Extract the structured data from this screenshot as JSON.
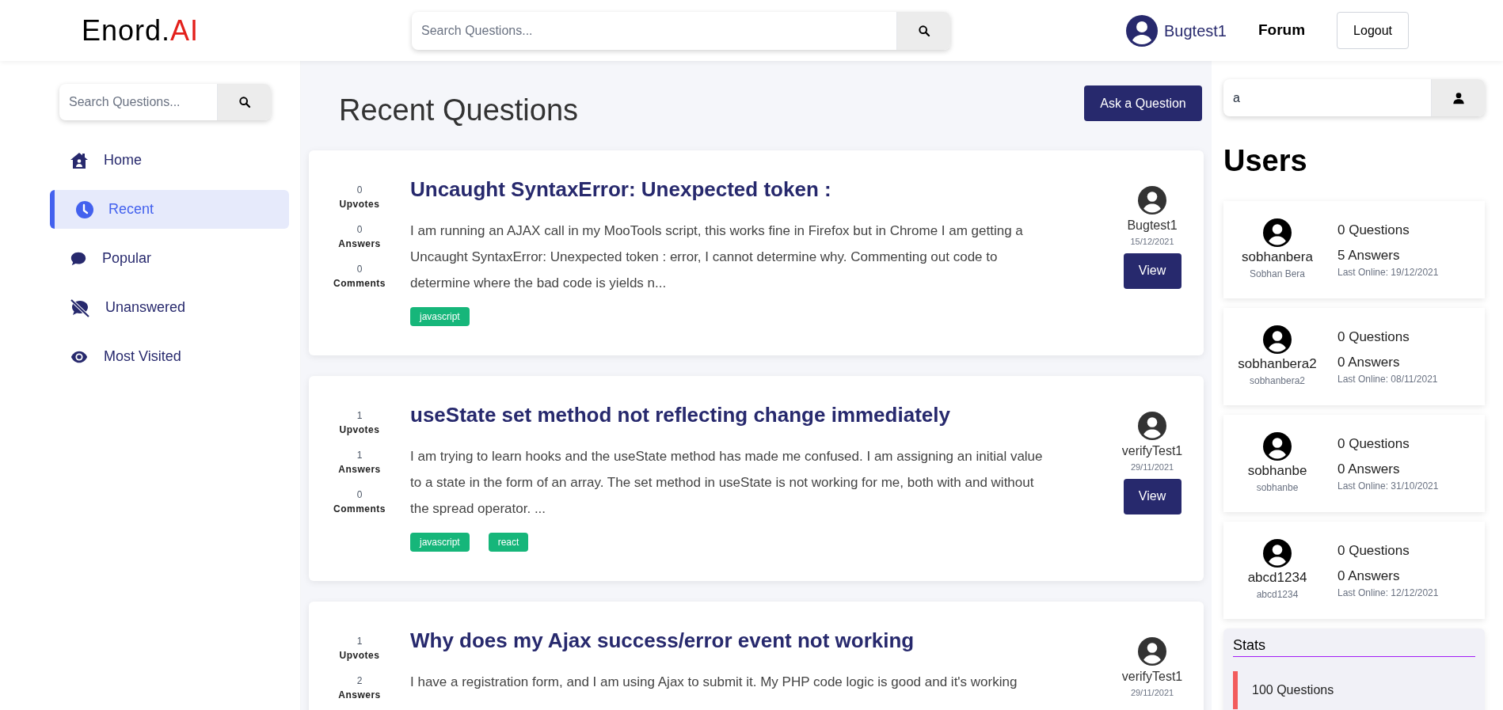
{
  "header": {
    "logo": {
      "main": "Enord.",
      "accent": "AI"
    },
    "search": {
      "placeholder": "Search Questions..."
    },
    "user": "Bugtest1",
    "nav_link": "Forum",
    "logout": "Logout"
  },
  "sidebar": {
    "search": {
      "placeholder": "Search Questions..."
    },
    "items": [
      {
        "label": "Home",
        "selected": false
      },
      {
        "label": "Recent",
        "selected": true
      },
      {
        "label": "Popular",
        "selected": false
      },
      {
        "label": "Unanswered",
        "selected": false
      },
      {
        "label": "Most Visited",
        "selected": false
      }
    ]
  },
  "main": {
    "title": "Recent Questions",
    "ask_button": "Ask a Question",
    "questions": [
      {
        "stats": [
          {
            "count": "0",
            "label": "Upvotes"
          },
          {
            "count": "0",
            "label": "Answers"
          },
          {
            "count": "0",
            "label": "Comments"
          }
        ],
        "title": "Uncaught SyntaxError: Unexpected token :",
        "excerpt": "I am running an AJAX call in my MooTools script, this works fine in Firefox but in Chrome I am getting a Uncaught SyntaxError: Unexpected token : error, I cannot determine why. Commenting out code to determine where the bad code is yields n...",
        "tags": [
          "javascript"
        ],
        "author": "Bugtest1",
        "date": "15/12/2021",
        "button": "View"
      },
      {
        "stats": [
          {
            "count": "1",
            "label": "Upvotes"
          },
          {
            "count": "1",
            "label": "Answers"
          },
          {
            "count": "0",
            "label": "Comments"
          }
        ],
        "title": "useState set method not reflecting change immediately",
        "excerpt": "I am trying to learn hooks and the useState method has made me confused. I am assigning an initial value to a state in the form of an array. The set method in useState is not working for me, both with and without the spread operator. ...",
        "tags": [
          "javascript",
          "react"
        ],
        "author": "verifyTest1",
        "date": "29/11/2021",
        "button": "View"
      },
      {
        "stats": [
          {
            "count": "1",
            "label": "Upvotes"
          },
          {
            "count": "2",
            "label": "Answers"
          }
        ],
        "title": "Why does my Ajax success/error event not working",
        "excerpt": "I have a registration form, and I am using Ajax to submit it. My PHP code logic is good and it's working",
        "author": "verifyTest1",
        "date": "29/11/2021"
      }
    ]
  },
  "users_panel": {
    "search": {
      "value": "a"
    },
    "title": "Users",
    "users": [
      {
        "username": "sobhanbera",
        "name": "Sobhan Bera",
        "questions": "0 Questions",
        "answers": "5 Answers",
        "last_online": "Last Online: 19/12/2021"
      },
      {
        "username": "sobhanbera2",
        "name": "sobhanbera2",
        "questions": "0 Questions",
        "answers": "0 Answers",
        "last_online": "Last Online: 08/11/2021"
      },
      {
        "username": "sobhanbe",
        "name": "sobhanbe",
        "questions": "0 Questions",
        "answers": "0 Answers",
        "last_online": "Last Online: 31/10/2021"
      },
      {
        "username": "abcd1234",
        "name": "abcd1234",
        "questions": "0 Questions",
        "answers": "0 Answers",
        "last_online": "Last Online: 12/12/2021"
      }
    ],
    "stats": {
      "title": "Stats",
      "items": [
        "100 Questions"
      ]
    }
  }
}
